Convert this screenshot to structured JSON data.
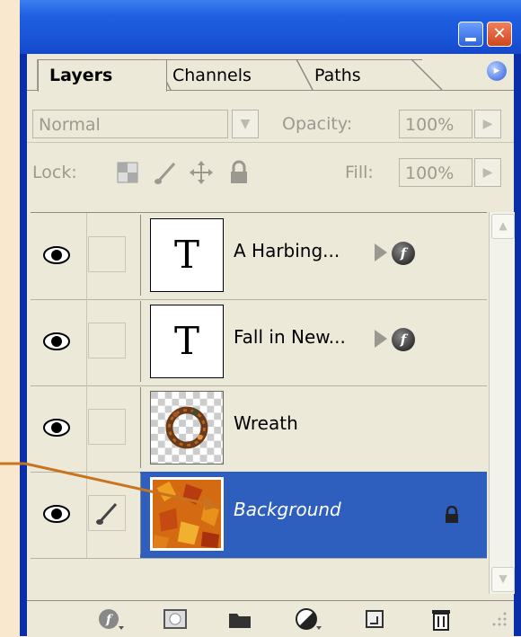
{
  "tabs": [
    {
      "label": "Layers"
    },
    {
      "label": "Channels"
    },
    {
      "label": "Paths"
    }
  ],
  "blend": {
    "mode": "Normal",
    "opacity_label": "Opacity:",
    "opacity_value": "100%"
  },
  "lock": {
    "label": "Lock:",
    "fill_label": "Fill:",
    "fill_value": "100%"
  },
  "layers": [
    {
      "name": "A Harbing...",
      "type": "text",
      "glyph": "T",
      "visible": true,
      "effects": true,
      "selected": false
    },
    {
      "name": "Fall in New...",
      "type": "text",
      "glyph": "T",
      "visible": true,
      "effects": true,
      "selected": false
    },
    {
      "name": "Wreath",
      "type": "image",
      "visible": true,
      "effects": false,
      "selected": false
    },
    {
      "name": "Background",
      "type": "image",
      "visible": true,
      "effects": false,
      "selected": true,
      "locked": true
    }
  ],
  "icons": {
    "effect": "f",
    "menu": "▸",
    "scroll_up": "▲",
    "scroll_down": "▼"
  },
  "colors": {
    "selection": "#2e5fbf",
    "annotation": "#c8741e",
    "titlebar": "#1f5fe0",
    "background": "#f9e8cd"
  }
}
